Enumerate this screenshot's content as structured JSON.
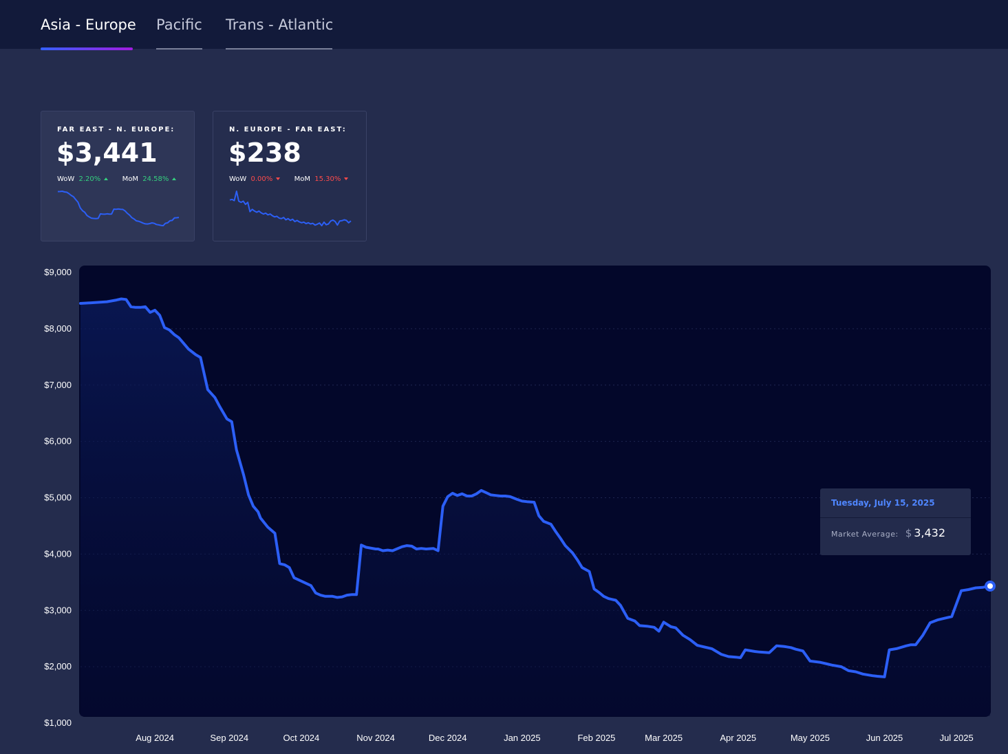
{
  "tabs": [
    {
      "label": "Asia - Europe",
      "active": true
    },
    {
      "label": "Pacific",
      "active": false
    },
    {
      "label": "Trans - Atlantic",
      "active": false
    }
  ],
  "cards": [
    {
      "title": "FAR EAST - N. EUROPE:",
      "value": "$3,441",
      "wow_label": "WoW",
      "wow_value": "2.20%",
      "wow_direction": "up",
      "mom_label": "MoM",
      "mom_value": "24.58%",
      "mom_direction": "up",
      "sparkline": [
        8450,
        8470,
        8520,
        8380,
        8330,
        8050,
        7700,
        7450,
        6900,
        6400,
        5300,
        4750,
        4450,
        3820,
        3550,
        3300,
        3250,
        3230,
        3270,
        4130,
        4080,
        4060,
        4140,
        4090,
        4100,
        5050,
        5020,
        5080,
        5030,
        5000,
        4700,
        4250,
        3900,
        3400,
        3150,
        2780,
        2700,
        2550,
        2350,
        2200,
        2170,
        2250,
        2380,
        2300,
        2080,
        2000,
        1900,
        1850,
        2300,
        2400,
        2800,
        2870,
        3350,
        3380,
        3441
      ],
      "active": true
    },
    {
      "title": "N. EUROPE - FAR EAST:",
      "value": "$238",
      "wow_label": "WoW",
      "wow_value": "0.00%",
      "wow_direction": "down",
      "mom_label": "MoM",
      "mom_value": "15.30%",
      "mom_direction": "down",
      "sparkline": [
        300,
        302,
        298,
        330,
        296,
        292,
        296,
        285,
        292,
        260,
        268,
        262,
        258,
        262,
        256,
        252,
        255,
        249,
        252,
        246,
        242,
        244,
        238,
        236,
        240,
        232,
        236,
        230,
        234,
        226,
        230,
        225,
        222,
        224,
        219,
        222,
        218,
        220,
        214,
        217,
        221,
        212,
        224,
        215,
        218,
        228,
        231,
        226,
        214,
        228,
        229,
        232,
        230,
        222,
        228
      ],
      "active": false
    }
  ],
  "colors": {
    "line": "#2c5ff6",
    "accent_gradient": [
      "#3461ff",
      "#a21ce0"
    ],
    "up": "#35d07f",
    "down": "#ff4b4b"
  },
  "tooltip": {
    "date": "Tuesday, July 15, 2025",
    "label": "Market Average:",
    "currency": "$",
    "value": "3,432"
  },
  "chart_data": {
    "type": "area",
    "title": "",
    "xlabel": "",
    "ylabel": "",
    "ylim": [
      1000,
      9000
    ],
    "xlim": [
      "2024-07-01",
      "2025-07-15"
    ],
    "y_ticks": [
      1000,
      2000,
      3000,
      4000,
      5000,
      6000,
      7000,
      8000,
      9000
    ],
    "y_tick_labels": [
      "$1,000",
      "$2,000",
      "$3,000",
      "$4,000",
      "$5,000",
      "$6,000",
      "$7,000",
      "$8,000",
      "$9,000"
    ],
    "x_ticks": [
      "2024-08-01",
      "2024-09-01",
      "2024-10-01",
      "2024-11-01",
      "2024-12-01",
      "2025-01-01",
      "2025-02-01",
      "2025-03-01",
      "2025-04-01",
      "2025-05-01",
      "2025-06-01",
      "2025-07-01"
    ],
    "x_tick_labels": [
      "Aug 2024",
      "Sep 2024",
      "Oct 2024",
      "Nov 2024",
      "Dec 2024",
      "Jan 2025",
      "Feb 2025",
      "Mar 2025",
      "Apr 2025",
      "May 2025",
      "Jun 2025",
      "Jul 2025"
    ],
    "grid": true,
    "series": [
      {
        "name": "Market Average",
        "x": [
          "2024-07-01",
          "2024-07-05",
          "2024-07-12",
          "2024-07-16",
          "2024-07-18",
          "2024-07-20",
          "2024-07-22",
          "2024-07-24",
          "2024-07-26",
          "2024-07-28",
          "2024-07-30",
          "2024-08-01",
          "2024-08-03",
          "2024-08-05",
          "2024-08-07",
          "2024-08-09",
          "2024-08-11",
          "2024-08-13",
          "2024-08-15",
          "2024-08-18",
          "2024-08-20",
          "2024-08-23",
          "2024-08-26",
          "2024-08-28",
          "2024-08-31",
          "2024-09-02",
          "2024-09-04",
          "2024-09-07",
          "2024-09-09",
          "2024-09-11",
          "2024-09-13",
          "2024-09-14",
          "2024-09-17",
          "2024-09-20",
          "2024-09-22",
          "2024-09-24",
          "2024-09-26",
          "2024-09-28",
          "2024-10-01",
          "2024-10-05",
          "2024-10-07",
          "2024-10-09",
          "2024-10-11",
          "2024-10-14",
          "2024-10-16",
          "2024-10-18",
          "2024-10-20",
          "2024-10-22",
          "2024-10-24",
          "2024-10-26",
          "2024-10-28",
          "2024-11-01",
          "2024-11-02",
          "2024-11-04",
          "2024-11-06",
          "2024-11-08",
          "2024-11-12",
          "2024-11-14",
          "2024-11-16",
          "2024-11-18",
          "2024-11-20",
          "2024-11-22",
          "2024-11-25",
          "2024-11-27",
          "2024-11-29",
          "2024-12-01",
          "2024-12-03",
          "2024-12-05",
          "2024-12-07",
          "2024-12-09",
          "2024-12-11",
          "2024-12-13",
          "2024-12-15",
          "2024-12-17",
          "2024-12-19",
          "2024-12-21",
          "2024-12-23",
          "2024-12-25",
          "2024-12-27",
          "2024-12-30",
          "2025-01-01",
          "2025-01-03",
          "2025-01-06",
          "2025-01-08",
          "2025-01-10",
          "2025-01-13",
          "2025-01-15",
          "2025-01-17",
          "2025-01-19",
          "2025-01-22",
          "2025-01-24",
          "2025-01-26",
          "2025-01-29",
          "2025-01-31",
          "2025-02-02",
          "2025-02-04",
          "2025-02-06",
          "2025-02-09",
          "2025-02-11",
          "2025-02-14",
          "2025-02-17",
          "2025-02-19",
          "2025-02-22",
          "2025-02-25",
          "2025-02-27",
          "2025-03-01",
          "2025-03-04",
          "2025-03-06",
          "2025-03-09",
          "2025-03-12",
          "2025-03-15",
          "2025-03-18",
          "2025-03-21",
          "2025-03-25",
          "2025-03-28",
          "2025-03-31",
          "2025-04-02",
          "2025-04-04",
          "2025-04-08",
          "2025-04-10",
          "2025-04-14",
          "2025-04-17",
          "2025-04-20",
          "2025-04-23",
          "2025-04-25",
          "2025-04-28",
          "2025-05-01",
          "2025-05-05",
          "2025-05-08",
          "2025-05-10",
          "2025-05-14",
          "2025-05-17",
          "2025-05-20",
          "2025-05-23",
          "2025-05-27",
          "2025-05-29",
          "2025-06-01",
          "2025-06-03",
          "2025-06-06",
          "2025-06-10",
          "2025-06-12",
          "2025-06-14",
          "2025-06-17",
          "2025-06-20",
          "2025-06-23",
          "2025-06-26",
          "2025-06-28",
          "2025-06-29",
          "2025-07-03",
          "2025-07-06",
          "2025-07-09",
          "2025-07-12",
          "2025-07-15"
        ],
        "y": [
          8450,
          8460,
          8480,
          8510,
          8530,
          8520,
          8390,
          8380,
          8380,
          8390,
          8290,
          8330,
          8240,
          8020,
          7980,
          7900,
          7840,
          7740,
          7640,
          7540,
          7490,
          6920,
          6780,
          6620,
          6400,
          6350,
          5850,
          5400,
          5050,
          4850,
          4750,
          4640,
          4480,
          4370,
          3830,
          3810,
          3760,
          3580,
          3520,
          3440,
          3310,
          3270,
          3250,
          3250,
          3230,
          3240,
          3270,
          3280,
          3280,
          4160,
          4120,
          4090,
          4090,
          4060,
          4070,
          4060,
          4130,
          4150,
          4140,
          4090,
          4100,
          4090,
          4100,
          4060,
          4850,
          5020,
          5080,
          5040,
          5070,
          5030,
          5030,
          5070,
          5130,
          5090,
          5050,
          5040,
          5030,
          5030,
          5020,
          4970,
          4940,
          4930,
          4920,
          4680,
          4580,
          4530,
          4400,
          4280,
          4150,
          4020,
          3900,
          3760,
          3690,
          3380,
          3320,
          3250,
          3210,
          3180,
          3090,
          2860,
          2810,
          2730,
          2720,
          2700,
          2630,
          2790,
          2710,
          2690,
          2560,
          2480,
          2380,
          2350,
          2320,
          2220,
          2180,
          2170,
          2160,
          2300,
          2270,
          2260,
          2250,
          2370,
          2360,
          2340,
          2310,
          2280,
          2100,
          2080,
          2050,
          2030,
          2000,
          1930,
          1910,
          1870,
          1840,
          1830,
          1820,
          2300,
          2320,
          2370,
          2390,
          2390,
          2560,
          2780,
          2830,
          2860,
          2880,
          2890,
          3350,
          3370,
          3400,
          3410,
          3432
        ]
      }
    ],
    "highlight": {
      "x": "2025-07-15",
      "y": 3432
    }
  }
}
